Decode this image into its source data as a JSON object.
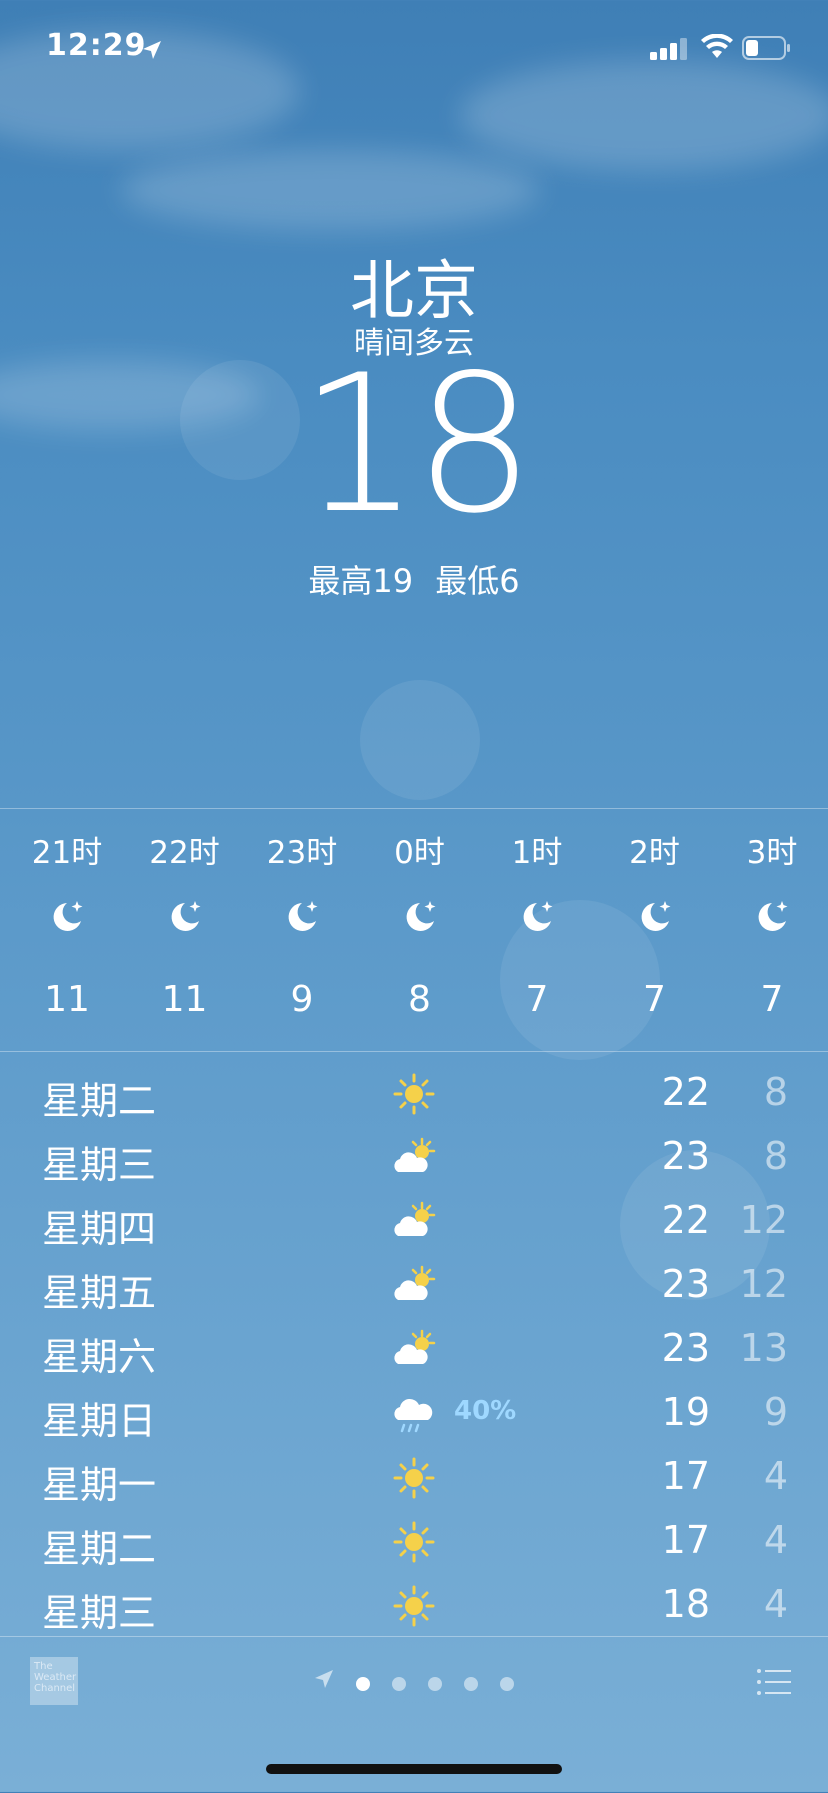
{
  "status_bar": {
    "time": "12:29"
  },
  "header": {
    "city": "北京",
    "condition": "晴间多云",
    "temperature": "18",
    "high": "最高19",
    "low": "最低6"
  },
  "hourly": [
    {
      "hour": "21时",
      "icon": "moon-star-icon",
      "temp": "11"
    },
    {
      "hour": "22时",
      "icon": "moon-star-icon",
      "temp": "11"
    },
    {
      "hour": "23时",
      "icon": "moon-star-icon",
      "temp": "9"
    },
    {
      "hour": "0时",
      "icon": "moon-star-icon",
      "temp": "8"
    },
    {
      "hour": "1时",
      "icon": "moon-star-icon",
      "temp": "7"
    },
    {
      "hour": "2时",
      "icon": "moon-star-icon",
      "temp": "7"
    },
    {
      "hour": "3时",
      "icon": "moon-star-icon",
      "temp": "7"
    }
  ],
  "daily": [
    {
      "day": "星期二",
      "icon": "sun-icon",
      "precip": "",
      "high": "22",
      "low": "8"
    },
    {
      "day": "星期三",
      "icon": "partly-cloudy-icon",
      "precip": "",
      "high": "23",
      "low": "8"
    },
    {
      "day": "星期四",
      "icon": "partly-cloudy-icon",
      "precip": "",
      "high": "22",
      "low": "12"
    },
    {
      "day": "星期五",
      "icon": "partly-cloudy-icon",
      "precip": "",
      "high": "23",
      "low": "12"
    },
    {
      "day": "星期六",
      "icon": "partly-cloudy-icon",
      "precip": "",
      "high": "23",
      "low": "13"
    },
    {
      "day": "星期日",
      "icon": "rain-icon",
      "precip": "40%",
      "high": "19",
      "low": "9"
    },
    {
      "day": "星期一",
      "icon": "sun-icon",
      "precip": "",
      "high": "17",
      "low": "4"
    },
    {
      "day": "星期二",
      "icon": "sun-icon",
      "precip": "",
      "high": "17",
      "low": "4"
    },
    {
      "day": "星期三",
      "icon": "sun-icon",
      "precip": "",
      "high": "18",
      "low": "4"
    }
  ],
  "footer": {
    "brand_text": "The Weather Channel",
    "page_dots": 5,
    "active_dot": 0
  },
  "colors": {
    "precip": "#9fd8ff",
    "sun": "#f5d14a"
  }
}
